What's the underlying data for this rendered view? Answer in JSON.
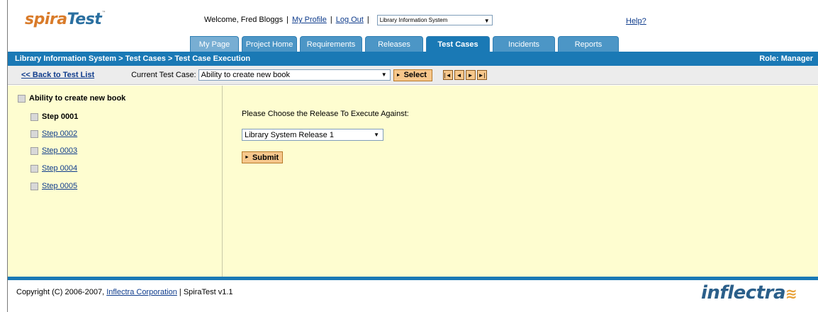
{
  "brand": {
    "logo_part1": "spira",
    "logo_part2": "Test",
    "logo_tm": "™",
    "footer_logo": "inflectra",
    "footer_logo_swoosh": "≋",
    "accent_blue": "#1a79b5",
    "accent_orange": "#f6c78c",
    "content_bg": "#fefdd0"
  },
  "header": {
    "welcome": "Welcome, Fred Bloggs",
    "my_profile": "My Profile",
    "log_out": "Log Out",
    "separator": "|",
    "project_select_value": "Library Information System",
    "help": "Help?"
  },
  "tabs": [
    {
      "label": "My Page"
    },
    {
      "label": "Project Home"
    },
    {
      "label": "Requirements"
    },
    {
      "label": "Releases"
    },
    {
      "label": "Test Cases",
      "active": true
    },
    {
      "label": "Incidents"
    },
    {
      "label": "Reports"
    }
  ],
  "breadcrumb": {
    "text": "Library Information System > Test Cases > Test Case Execution",
    "role": "Role: Manager"
  },
  "toolbar": {
    "back_link": "<< Back to Test List",
    "current_label": "Current Test Case:",
    "current_value": "Ability to create new book",
    "select_button": "Select",
    "nav_icons": [
      "first-icon",
      "previous-icon",
      "next-icon",
      "last-icon"
    ]
  },
  "tree": {
    "root": "Ability to create new book",
    "steps": [
      {
        "label": "Step 0001",
        "current": true
      },
      {
        "label": "Step 0002"
      },
      {
        "label": "Step 0003"
      },
      {
        "label": "Step 0004"
      },
      {
        "label": "Step 0005"
      }
    ]
  },
  "main": {
    "prompt": "Please Choose the Release To Execute Against:",
    "release_value": "Library System Release 1",
    "submit": "Submit"
  },
  "footer": {
    "copyright_prefix": "Copyright (C) 2006-2007,",
    "company": "Inflectra Corporation",
    "suffix": "| SpiraTest v1.1"
  }
}
